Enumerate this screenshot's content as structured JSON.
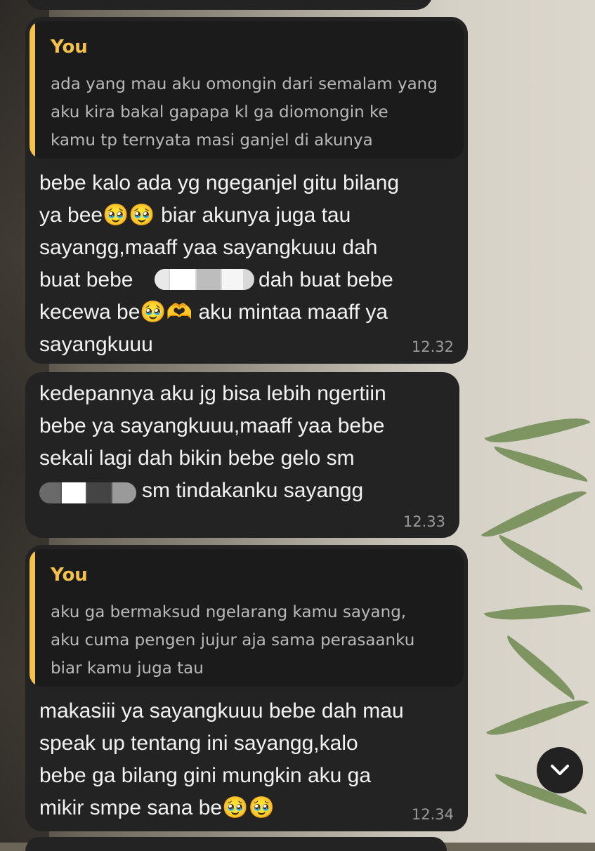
{
  "messages": [
    {
      "quote": {
        "name": "You",
        "text": "ada yang mau aku omongin dari semalam yang\naku kira bakal gapapa kl ga diomongin ke\nkamu tp ternyata masi ganjel di akunya"
      },
      "text_1": "bebe kalo ada yg ngeganjel gitu bilang\nya bee🥹🥹 biar akunya juga tau\nsayangg,maaff yaa sayangkuuu dah\nbuat bebe",
      "text_2": "dah buat bebe",
      "text_3": "kecewa be🥹🫶 aku mintaa maaff ya\nsayangkuuu",
      "time": "12.32"
    },
    {
      "text_1": "kedepannya aku jg bisa lebih ngertiin\nbebe ya sayangkuuu,maaff yaa bebe\nsekali lagi dah bikin bebe gelo sm",
      "text_2": "sm tindakanku sayangg",
      "time": "12.33"
    },
    {
      "quote": {
        "name": "You",
        "text": "aku ga bermaksud ngelarang kamu sayang,\naku cuma pengen jujur aja sama perasaanku\nbiar kamu juga tau"
      },
      "text_1": "makasiii ya sayangkuuu bebe dah mau\nspeak up tentang ini sayangg,kalo\nbebe ga bilang gini mungkin aku ga\nmikir smpe sana be🥹🥹",
      "time": "12.34"
    }
  ],
  "colors": {
    "bubble": "#232323",
    "quote_bg": "#1b1b1b",
    "quote_accent": "#f4c24a",
    "text": "#f2f2f2",
    "time": "#9a9a9a"
  },
  "icons": {
    "scroll_down": "chevron-down-icon"
  }
}
